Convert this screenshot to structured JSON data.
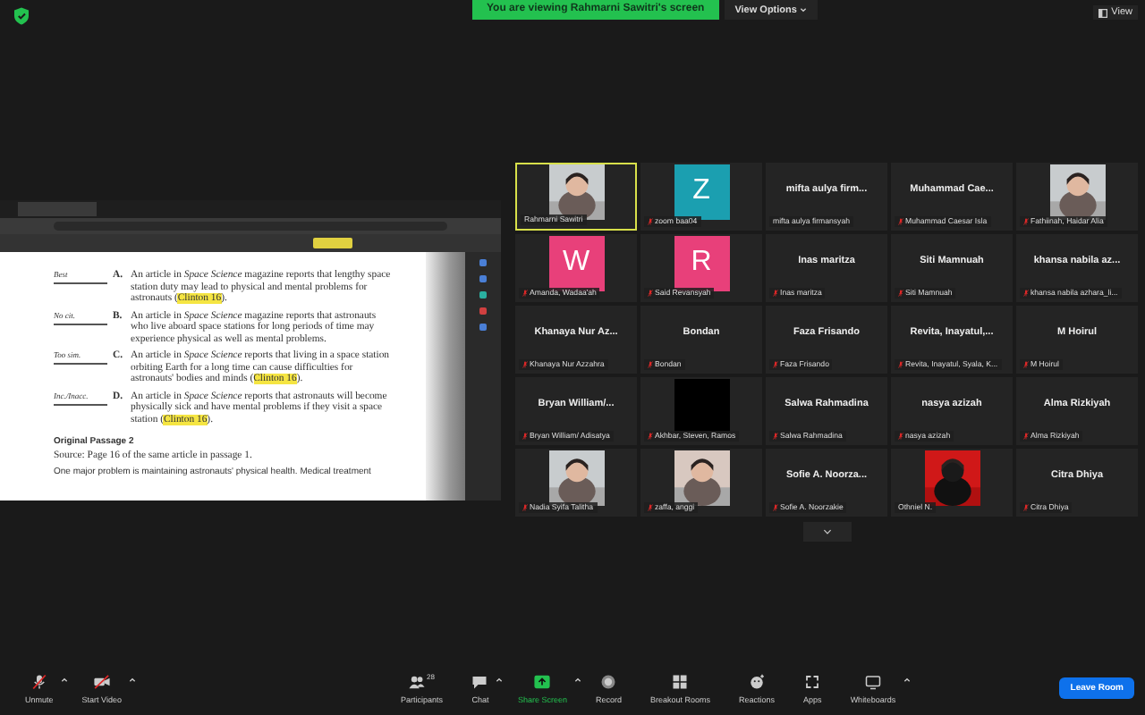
{
  "top_bar": {
    "banner": "You are viewing Rahmarni Sawitri's screen",
    "view_options": "View Options",
    "view": "View"
  },
  "shared_screen": {
    "document": {
      "items": [
        {
          "mark": "Best",
          "letter": "A.",
          "text": "An article in *Space Science* magazine reports that lengthy space station duty may lead to physical and mental problems for astronauts (",
          "cite": "Clinton 16",
          "end": ")."
        },
        {
          "mark": "No cit.",
          "letter": "B.",
          "text": "An article in *Space Science* magazine reports that astronauts who live aboard space stations for long periods of time may experience physical as well as mental problems."
        },
        {
          "mark": "Too sim.",
          "letter": "C.",
          "text": "An article in *Space Science* reports that living in a space station orbiting Earth for a long time can cause difficulties for astronauts' bodies and minds (",
          "cite": "Clinton 16",
          "end": ")."
        },
        {
          "mark": "Inc./Inacc.",
          "letter": "D.",
          "text": "An article in *Space Science* reports that astronauts will become physically sick and have mental problems if they visit a space station (",
          "cite": "Clinton 16",
          "end": ")."
        }
      ],
      "heading": "Original Passage 2",
      "source": "Source: Page 16 of the same article in passage 1.",
      "paragraph": "One major problem is maintaining astronauts' physical health. Medical treatment"
    }
  },
  "tiles": [
    {
      "kind": "video",
      "name": "Rahmarni Sawitri",
      "muted": false,
      "highlighted": true
    },
    {
      "kind": "avatar",
      "name": "zoom baa04",
      "letter": "Z",
      "color": "#1b9fb0",
      "muted": true,
      "highlighted": false
    },
    {
      "kind": "name",
      "name": "mifta aulya firmansyah",
      "display": "mifta aulya firm...",
      "muted": false,
      "highlighted": false
    },
    {
      "kind": "name",
      "name": "Muhammad Caesar Isla",
      "display": "Muhammad  Cae...",
      "muted": true,
      "highlighted": false
    },
    {
      "kind": "video",
      "name": "Fathiinah, Haidar Alia",
      "muted": true,
      "highlighted": false
    },
    {
      "kind": "avatar",
      "name": "Amanda, Wadaa'ah",
      "letter": "W",
      "color": "#e8407a",
      "muted": true,
      "highlighted": false
    },
    {
      "kind": "avatar",
      "name": "Said Revansyah",
      "letter": "R",
      "color": "#e8407a",
      "muted": true,
      "highlighted": false
    },
    {
      "kind": "name",
      "name": "Inas maritza",
      "display": "Inas maritza",
      "muted": true,
      "highlighted": false
    },
    {
      "kind": "name",
      "name": "Siti Mamnuah",
      "display": "Siti Mamnuah",
      "muted": true,
      "highlighted": false
    },
    {
      "kind": "name",
      "name": "khansa nabila azhara_li...",
      "display": "khansa  nabila  az...",
      "muted": true,
      "highlighted": false
    },
    {
      "kind": "name",
      "name": "Khanaya Nur Azzahra",
      "display": "Khanaya Nur Az...",
      "muted": true,
      "highlighted": false
    },
    {
      "kind": "name",
      "name": "Bondan",
      "display": "Bondan",
      "muted": true,
      "highlighted": false
    },
    {
      "kind": "name",
      "name": "Faza Frisando",
      "display": "Faza Frisando",
      "muted": true,
      "highlighted": false
    },
    {
      "kind": "name",
      "name": "Revita, Inayatul, Syala, K...",
      "display": "Revita,  Inayatul,...",
      "muted": true,
      "highlighted": false
    },
    {
      "kind": "name",
      "name": "M Hoirul",
      "display": "M Hoirul",
      "muted": true,
      "highlighted": false
    },
    {
      "kind": "name",
      "name": "Bryan William/ Adisatya",
      "display": "Bryan  William/...",
      "muted": true,
      "highlighted": false
    },
    {
      "kind": "blank",
      "name": "Akhbar, Steven, Ramos",
      "muted": true,
      "highlighted": false
    },
    {
      "kind": "name",
      "name": "Salwa Rahmadina",
      "display": "Salwa Rahmadina",
      "muted": true,
      "highlighted": false
    },
    {
      "kind": "name",
      "name": "nasya azizah",
      "display": "nasya azizah",
      "muted": true,
      "highlighted": false
    },
    {
      "kind": "name",
      "name": "Alma Rizkiyah",
      "display": "Alma Rizkiyah",
      "muted": true,
      "highlighted": false
    },
    {
      "kind": "video",
      "name": "Nadia Syifa Talitha",
      "muted": true,
      "highlighted": false
    },
    {
      "kind": "video",
      "name": "zaffa, anggi",
      "muted": true,
      "highlighted": false
    },
    {
      "kind": "name",
      "name": "Sofie A. Noorzakie",
      "display": "Sofie A. Noorza...",
      "muted": true,
      "highlighted": false
    },
    {
      "kind": "video",
      "name": "Othniel N.",
      "muted": false,
      "highlighted": false
    },
    {
      "kind": "name",
      "name": "Citra Dhiya",
      "display": "Citra Dhiya",
      "muted": true,
      "highlighted": false
    }
  ],
  "toolbar": {
    "left": [
      {
        "kind": "mic",
        "label": "Unmute"
      },
      {
        "kind": "camera",
        "label": "Start Video"
      }
    ],
    "center": [
      {
        "kind": "participants",
        "label": "Participants",
        "count": "28"
      },
      {
        "kind": "chat",
        "label": "Chat"
      },
      {
        "kind": "share",
        "label": "Share Screen"
      },
      {
        "kind": "record",
        "label": "Record"
      },
      {
        "kind": "breakout",
        "label": "Breakout Rooms"
      },
      {
        "kind": "reactions",
        "label": "Reactions"
      },
      {
        "kind": "apps",
        "label": "Apps"
      },
      {
        "kind": "whiteboards",
        "label": "Whiteboards"
      }
    ],
    "leave": "Leave Room"
  }
}
